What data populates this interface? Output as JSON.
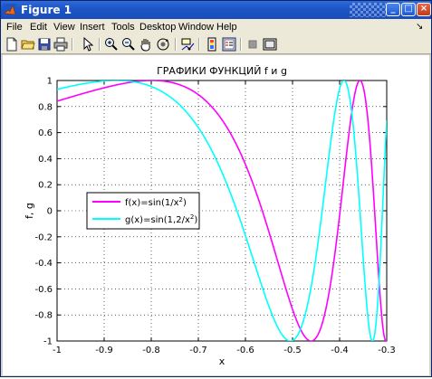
{
  "window": {
    "title": "Figure 1"
  },
  "menu": {
    "items": [
      "File",
      "Edit",
      "View",
      "Insert",
      "Tools",
      "Desktop",
      "Window",
      "Help"
    ]
  },
  "toolbar": {
    "icons": [
      "new-file-icon",
      "open-folder-icon",
      "save-icon",
      "print-icon",
      "pointer-icon",
      "zoom-in-icon",
      "zoom-out-icon",
      "pan-hand-icon",
      "rotate-3d-icon",
      "data-cursor-icon",
      "colorbar-icon",
      "legend-icon",
      "hide-plot-tools-icon",
      "show-plot-tools-icon"
    ]
  },
  "chart_data": {
    "type": "line",
    "title": "ГРАФИКИ ФУНКЦИЙ f и g",
    "xlabel": "x",
    "ylabel": "f, g",
    "xlim": [
      -1,
      -0.3
    ],
    "ylim": [
      -1,
      1
    ],
    "grid": true,
    "legend_position": "middle-left",
    "xticks": [
      "-1",
      "-0.9",
      "-0.8",
      "-0.7",
      "-0.6",
      "-0.5",
      "-0.4",
      "-0.3"
    ],
    "yticks": [
      "1",
      "0.8",
      "0.6",
      "0.4",
      "0.2",
      "0",
      "-0.2",
      "-0.4",
      "-0.6",
      "-0.8",
      "-1"
    ],
    "series": [
      {
        "name": "f(x)=sin(1/x^2)",
        "label_main": "f(x)=sin(1/x",
        "label_exp": "2",
        "label_tail": ")",
        "color": "#ff00ff",
        "expr": "sin(1/x^2)"
      },
      {
        "name": "g(x)=sin(1,2/x^2)",
        "label_main": "g(x)=sin(1,2/x",
        "label_exp": "2",
        "label_tail": ")",
        "color": "#00ffff",
        "expr": "sin(1.2/x^2)"
      }
    ]
  }
}
